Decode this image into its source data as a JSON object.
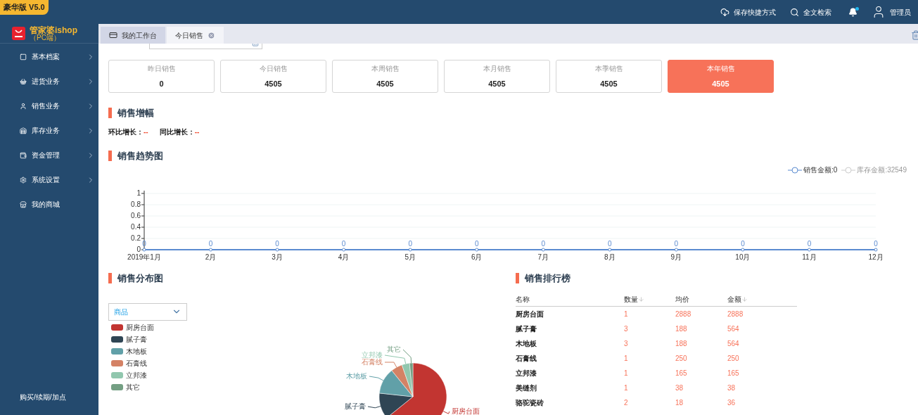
{
  "edition_badge": "豪华版 V5.0",
  "logo": {
    "name": "管家婆ishop",
    "subtitle": "（PC端）"
  },
  "header": {
    "actions": [
      {
        "kind": "cloud",
        "label": "保存快捷方式"
      },
      {
        "kind": "search",
        "label": "全文检索"
      }
    ],
    "notification_dot": true,
    "user": "管理员"
  },
  "sidebar": {
    "items": [
      {
        "kind": "archive",
        "label": "基本档案",
        "has_submenu": true
      },
      {
        "kind": "basket",
        "label": "进货业务",
        "has_submenu": true
      },
      {
        "kind": "user",
        "label": "销售业务",
        "has_submenu": true
      },
      {
        "kind": "warehouse",
        "label": "库存业务",
        "has_submenu": true
      },
      {
        "kind": "wallet",
        "label": "资金管理",
        "has_submenu": true
      },
      {
        "kind": "settings",
        "label": "系统设置",
        "has_submenu": true
      },
      {
        "kind": "store",
        "label": "我的商城",
        "has_submenu": false
      }
    ],
    "footer": "购买/续期/加点"
  },
  "tabs": [
    {
      "label": "我的工作台",
      "selected": false,
      "closable": false
    },
    {
      "label": "今日销售",
      "selected": true,
      "closable": true
    }
  ],
  "stats": [
    {
      "label": "昨日销售",
      "value": "0",
      "selected": false
    },
    {
      "label": "今日销售",
      "value": "4505",
      "selected": false
    },
    {
      "label": "本周销售",
      "value": "4505",
      "selected": false
    },
    {
      "label": "本月销售",
      "value": "4505",
      "selected": false
    },
    {
      "label": "本季销售",
      "value": "4505",
      "selected": false
    },
    {
      "label": "本年销售",
      "value": "4505",
      "selected": true
    }
  ],
  "growth": {
    "title": "销售增幅",
    "items": [
      {
        "label": "环比增长：",
        "value": "--"
      },
      {
        "label": "同比增长：",
        "value": "--"
      }
    ]
  },
  "trend": {
    "title": "销售趋势图",
    "legend": [
      {
        "label": "销售金额:0",
        "on": true
      },
      {
        "label": "库存金额:32549",
        "on": false
      }
    ],
    "chart_data": {
      "type": "line",
      "categories": [
        "2019年1月",
        "2月",
        "3月",
        "4月",
        "5月",
        "6月",
        "7月",
        "8月",
        "9月",
        "10月",
        "11月",
        "12月"
      ],
      "series": [
        {
          "color": "#5b8bd0",
          "marker": true,
          "values": [
            0,
            0,
            0,
            0,
            0,
            0,
            0,
            0,
            0,
            0,
            0,
            0
          ]
        }
      ],
      "grid": true,
      "ylim": [
        0,
        1
      ],
      "yticks": [
        0,
        0.2,
        0.4,
        0.6,
        0.8,
        1
      ],
      "data_labels": true
    }
  },
  "distribution": {
    "title": "销售分布图",
    "dimension": "商品",
    "chart_data": {
      "type": "pie",
      "categories": [
        "厨房台面",
        "腻子膏",
        "木地板",
        "石膏线",
        "立邦漆",
        "其它"
      ],
      "series": [
        {
          "values": [
            64.2,
            12.5,
            12.5,
            5.5,
            3.7,
            1.6
          ]
        }
      ],
      "colors": [
        "#c23531",
        "#2f4554",
        "#61a0a8",
        "#d48265",
        "#91c7ae",
        "#749f83"
      ]
    }
  },
  "ranking": {
    "title": "销售排行榜",
    "columns": [
      {
        "label": "名称",
        "sortable": false
      },
      {
        "label": "数量",
        "sortable": true
      },
      {
        "label": "均价",
        "sortable": false
      },
      {
        "label": "金额",
        "sortable": true
      }
    ],
    "rows": [
      [
        "厨房台面",
        "1",
        "2888",
        "2888"
      ],
      [
        "腻子膏",
        "3",
        "188",
        "564"
      ],
      [
        "木地板",
        "3",
        "188",
        "564"
      ],
      [
        "石膏线",
        "1",
        "250",
        "250"
      ],
      [
        "立邦漆",
        "1",
        "165",
        "165"
      ],
      [
        "美缝剂",
        "1",
        "38",
        "38"
      ],
      [
        "骆驼瓷砖",
        "2",
        "18",
        "36"
      ]
    ]
  }
}
